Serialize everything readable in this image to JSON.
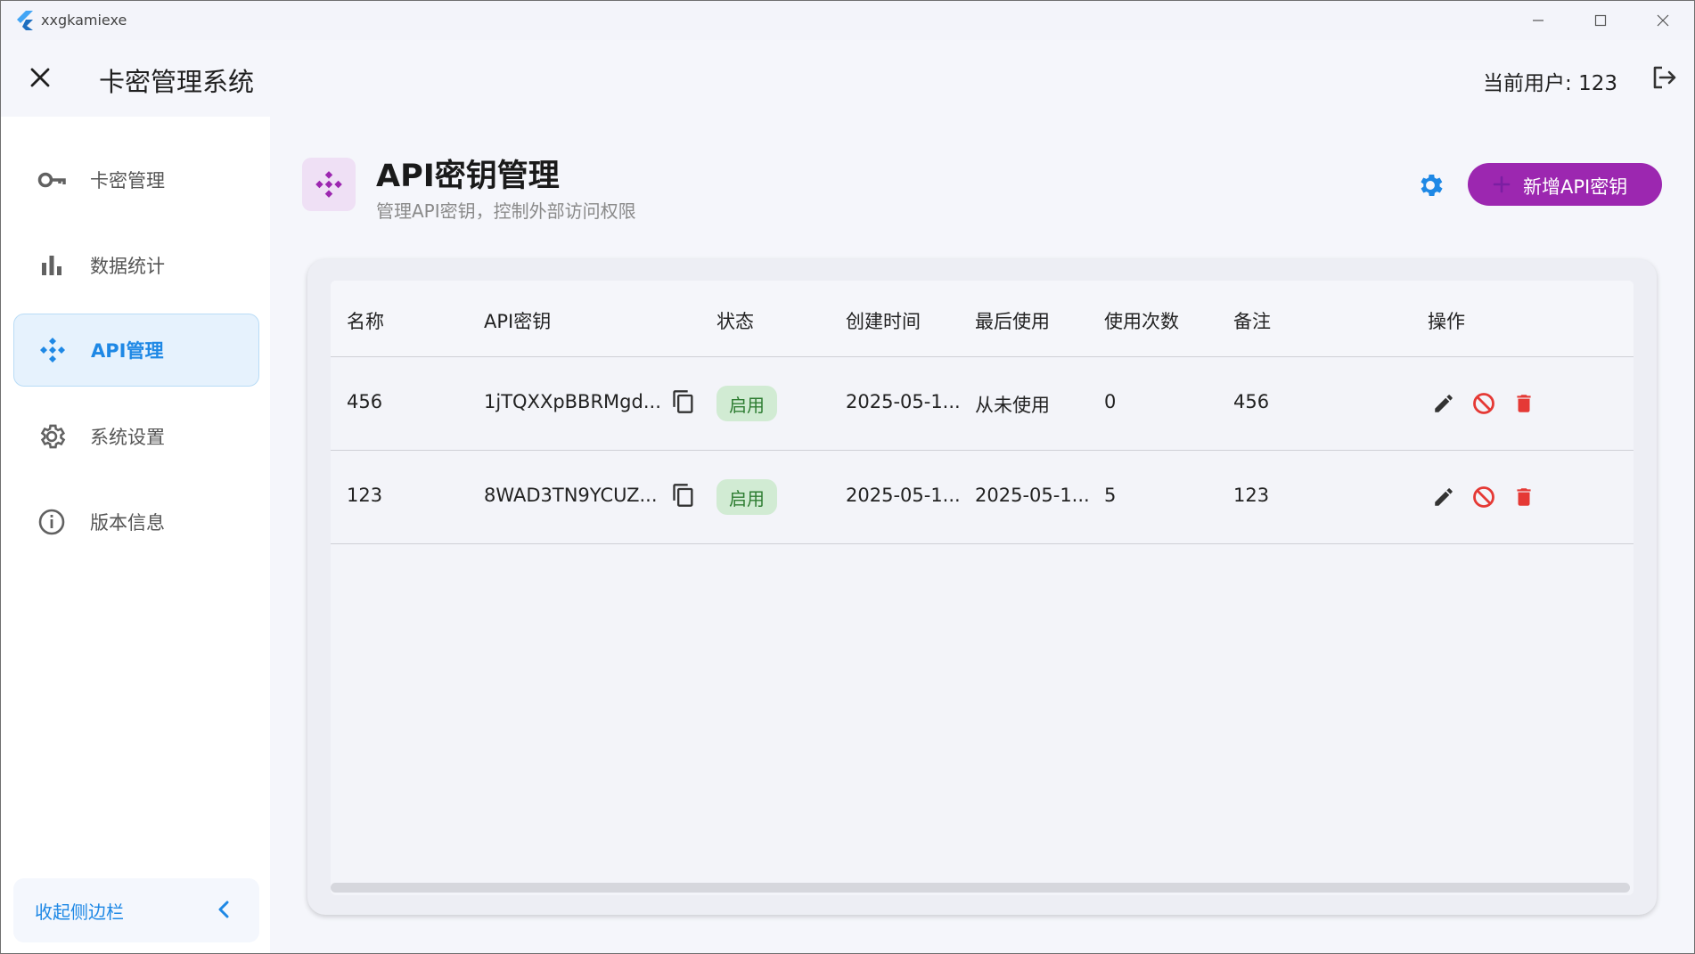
{
  "window": {
    "app_name": "xxgkamiexe"
  },
  "header": {
    "title": "卡密管理系统",
    "current_user": "当前用户: 123"
  },
  "sidebar": {
    "items": [
      {
        "label": "卡密管理",
        "icon": "key-icon"
      },
      {
        "label": "数据统计",
        "icon": "bar-chart-icon"
      },
      {
        "label": "API管理",
        "icon": "api-icon",
        "active": true
      },
      {
        "label": "系统设置",
        "icon": "gear-icon"
      },
      {
        "label": "版本信息",
        "icon": "info-icon"
      }
    ],
    "collapse_label": "收起侧边栏"
  },
  "page": {
    "title": "API密钥管理",
    "subtitle": "管理API密钥，控制外部访问权限",
    "add_button_label": "新增API密钥"
  },
  "table": {
    "columns": [
      "名称",
      "API密钥",
      "状态",
      "创建时间",
      "最后使用",
      "使用次数",
      "备注",
      "操作"
    ],
    "rows": [
      {
        "name": "456",
        "key": "1jTQXXpBBRMgd...",
        "status": "启用",
        "created": "2025-05-1...",
        "last_used": "从未使用",
        "count": "0",
        "note": "456"
      },
      {
        "name": "123",
        "key": "8WAD3TN9YCUZ...",
        "status": "启用",
        "created": "2025-05-1...",
        "last_used": "2025-05-1...",
        "count": "5",
        "note": "123"
      }
    ]
  },
  "colors": {
    "accent_blue": "#1e88e5",
    "accent_purple": "#9c27b0",
    "status_green": "#2e7d32",
    "danger_red": "#e53935"
  }
}
